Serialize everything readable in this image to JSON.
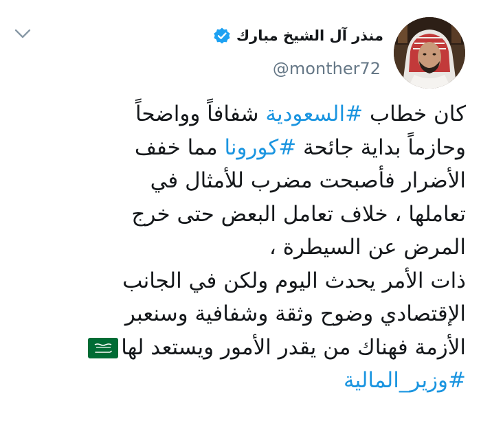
{
  "author": {
    "display_name": "منذر آل الشيخ مبارك",
    "handle": "@monther72",
    "verified": true
  },
  "tweet": {
    "line1": {
      "before": "كان خطاب ",
      "tag": "#السعودية",
      "after": " شفافاً وواضحاً"
    },
    "line2": {
      "before": "وحازماً بداية جائحة ",
      "tag": "#كورونا",
      "after": " مما خفف"
    },
    "line3": "الأضرار فأصبحت مضرب للأمثال في",
    "line4": "تعاملها ، خلاف تعامل البعض حتى خرج",
    "line5": "المرض عن السيطرة ،",
    "line6": "ذات الأمر يحدث اليوم ولكن في الجانب",
    "line7": "الإقتصادي وضوح وثقة وشفافية وسنعبر",
    "line8": "الأزمة فهناك من يقدر الأمور ويستعد لها",
    "line9_tag": "#وزير_المالية",
    "emoji": "saudi-flag-emoji"
  },
  "colors": {
    "hashtag": "#1b95e0",
    "verified_badge": "#1da1f2",
    "handle": "#657786",
    "text": "#14171a",
    "flag_green": "#006c35"
  },
  "icons": {
    "menu": "chevron-down-icon",
    "verified": "verified-badge-icon"
  }
}
